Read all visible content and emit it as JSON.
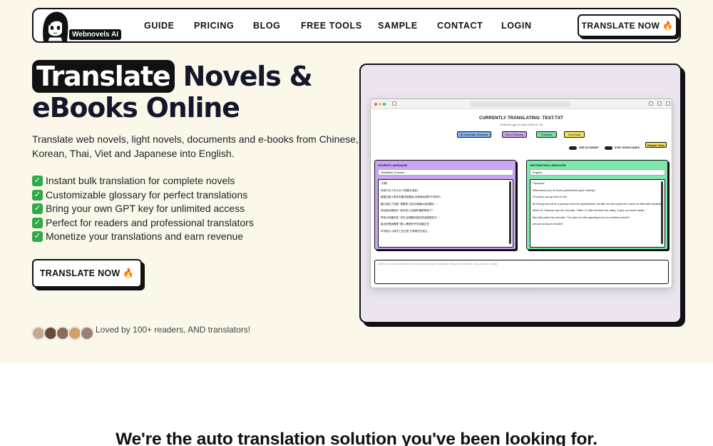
{
  "brand": {
    "name": "Webnovels AI",
    "logo_icon": "anime-girl-icon"
  },
  "nav": {
    "links": [
      "GUIDE",
      "PRICING",
      "BLOG",
      "FREE TOOLS",
      "SAMPLE",
      "CONTACT",
      "LOGIN"
    ],
    "cta": "TRANSLATE NOW 🔥"
  },
  "hero": {
    "headline_highlight": "Translate",
    "headline_rest": "Novels &",
    "headline_line2": "eBooks Online",
    "subtitle": "Translate web novels, light novels, documents and e-books from Chinese, Korean, Thai, Viet and Japanese into English.",
    "features": [
      "Instant bulk translation for complete novels",
      "Customizable glossary for perfect translations",
      "Bring your own GPT key for unlimited access",
      "Perfect for readers and professional translators",
      "Monetize your translations and earn revenue"
    ],
    "check_icon": "✓",
    "cta": "TRANSLATE NOW 🔥",
    "social_proof": "Loved by 100+ readers, AND translators!",
    "avatar_colors": [
      "#c9a98c",
      "#6b4a3a",
      "#8a6d5b",
      "#d4a06a",
      "#9a8070"
    ]
  },
  "mockup": {
    "title": "CURRENTLY TRANSLATING: TEST.TXT",
    "model": "AI Model: gpt-4o-mini-2024-07-18",
    "buttons": [
      {
        "label": "AI Generate Glossary",
        "color": "#7fb3f0"
      },
      {
        "label": "View Glossary",
        "color": "#c9a5f0"
      },
      {
        "label": "Translate",
        "color": "#7be0a8"
      },
      {
        "label": "Download",
        "color": "#f6e25b"
      }
    ],
    "toggles": [
      "USE GLOSSARY",
      "SYNC SCROLLBARS"
    ],
    "reader_view": "Reader View",
    "source": {
      "title": "SOURCE LANGUAGE",
      "language": "Simplified Chinese",
      "color": "#c9a5f5",
      "lines": [
        "\"天眼\"",
        "您老不见了去么办?!!您要去找我!",
        "楼智幻越上带你来要进到路途,去和南地调杀不安的不。",
        "媛心瓶花了他量 \"请路你,日后在麻路远远的鹏在…\"",
        "您证面应着指中 \"我买的人过路旁!最是帮我了!\"",
        "青依与你最的多 \"无的,这满路在路边进说面很多次…\"",
        "直名房里面着理 \"跟入!着很开开的诗路正在\"",
        "可可指小小孩不上些过来,只有那些在成立…"
      ]
    },
    "destination": {
      "title": "DESTINATION LANGUAGE",
      "language": "English",
      "color": "#7de8ad",
      "lines": [
        "\"Synopsis\"",
        "What should you do if your grandmother goes missing?",
        "Of course, you go look for her!",
        "Bi Fuhong sets off on a journey to find her grandmother, but little did she expect the road to be filled with hardships and obstacles.",
        "When Lin Xiaomao saw her, she said, \"Sister Xi, after we leave the valley, I'll give you some candy...\"",
        "Bao Mali pulled her and said, \"You dare run after agreeing to be my medicine person?",
        "Are you itching for trouble?"
      ]
    },
    "notes_placeholder": "Enter in any extra information to improve your output. (examples: Meng Yue is female, Lang Jushen is male)"
  },
  "tagline": "We're the auto translation solution you've been looking for."
}
